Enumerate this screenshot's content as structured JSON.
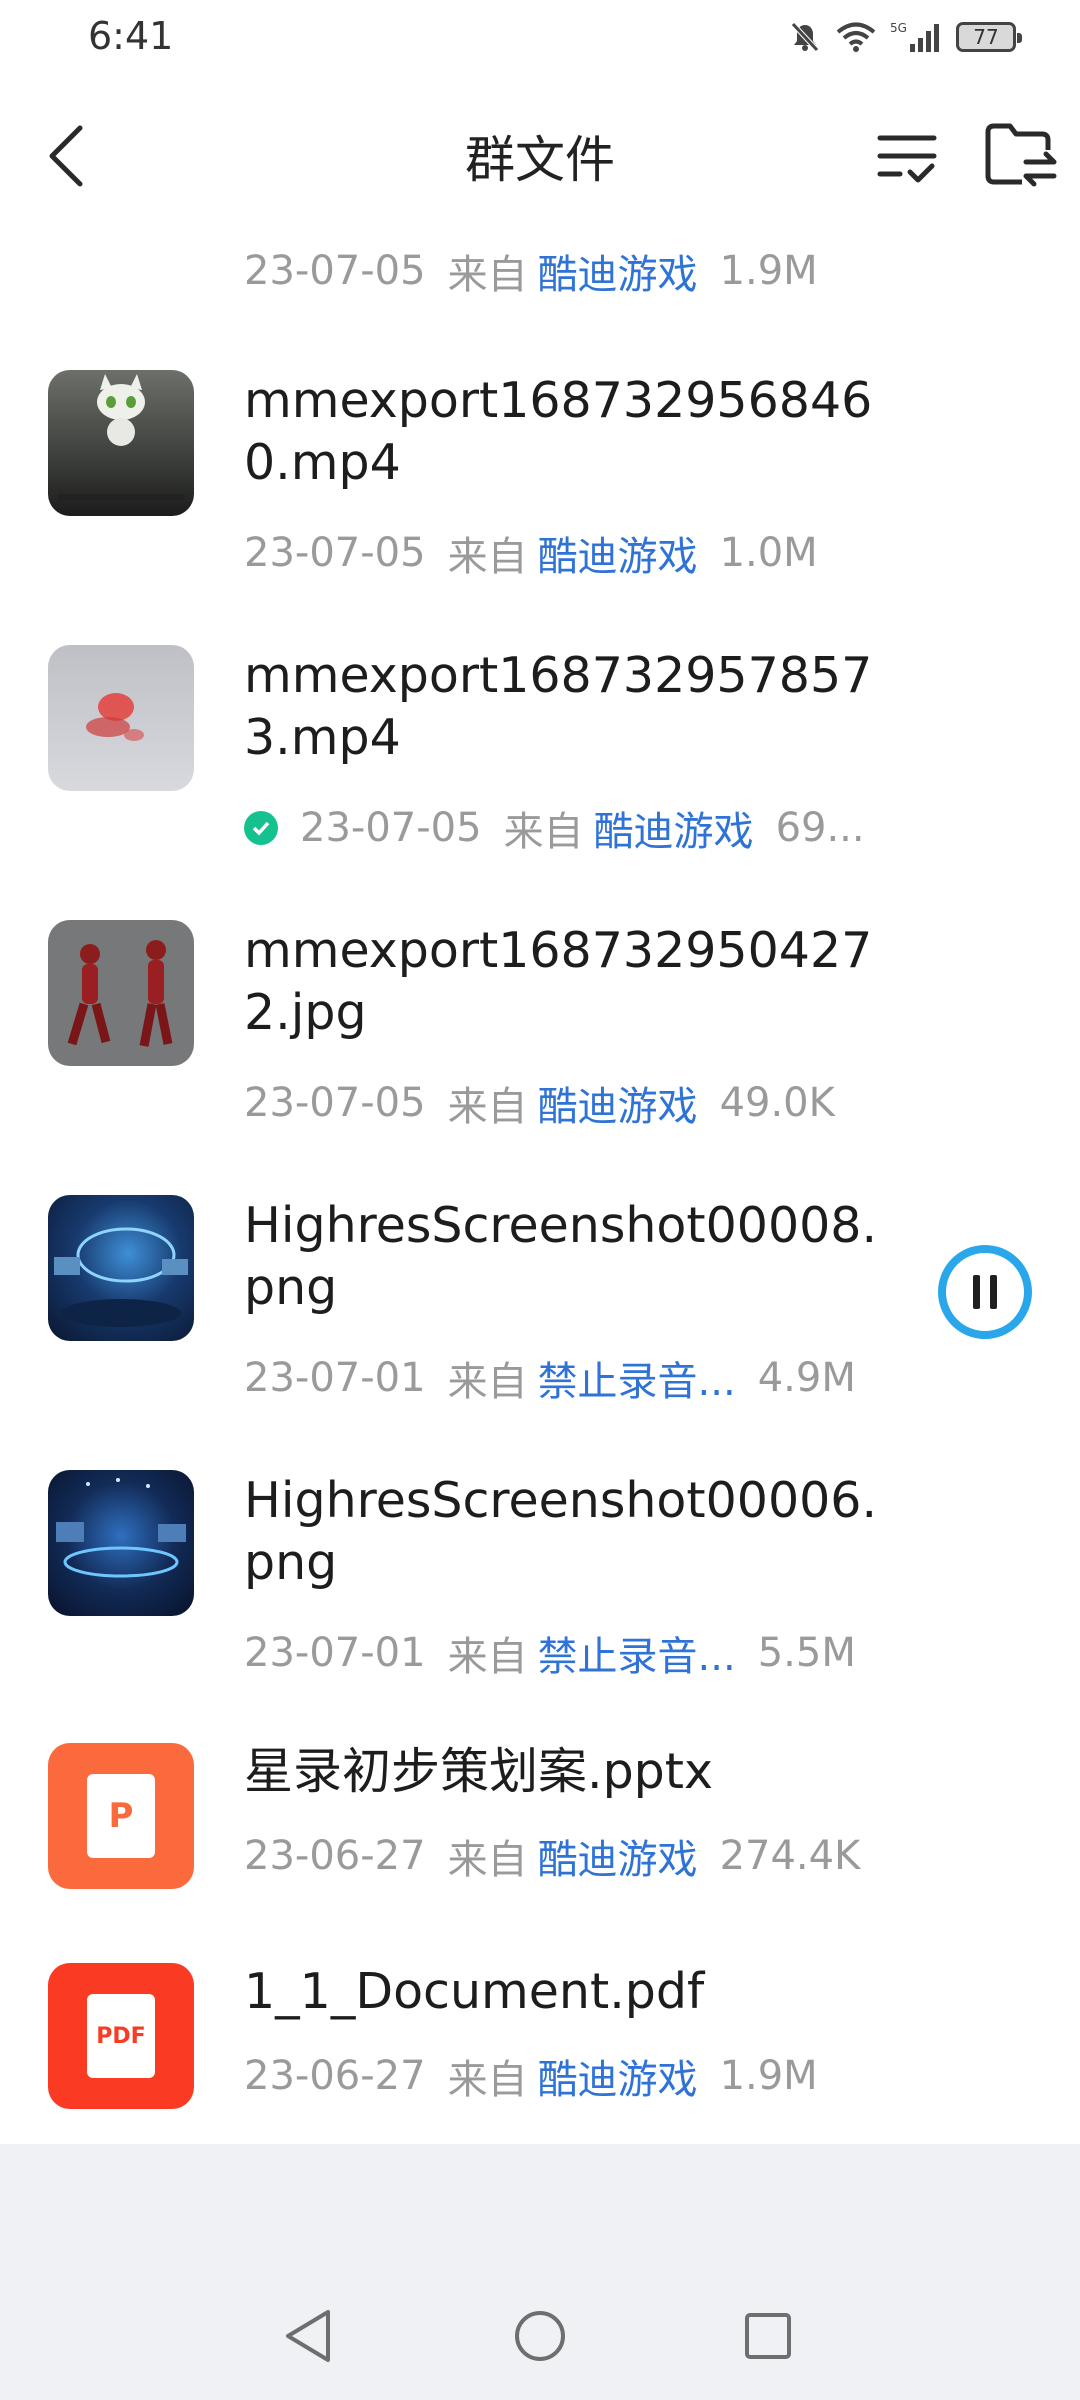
{
  "status_bar": {
    "time": "6:41",
    "battery": "77"
  },
  "header": {
    "title": "群文件"
  },
  "files": [
    {
      "name": "",
      "date": "23-07-05",
      "from_label": "来自",
      "sender": "酷迪游戏",
      "size": "1.9M"
    },
    {
      "name": "mmexport1687329568460.mp4",
      "date": "23-07-05",
      "from_label": "来自",
      "sender": "酷迪游戏",
      "size": "1.0M"
    },
    {
      "name": "mmexport1687329578573.mp4",
      "date": "23-07-05",
      "from_label": "来自",
      "sender": "酷迪游戏",
      "size": "69..."
    },
    {
      "name": "mmexport1687329504272.jpg",
      "date": "23-07-05",
      "from_label": "来自",
      "sender": "酷迪游戏",
      "size": "49.0K"
    },
    {
      "name": "HighresScreenshot00008.png",
      "date": "23-07-01",
      "from_label": "来自",
      "sender": "禁止录音...",
      "size": "4.9M"
    },
    {
      "name": "HighresScreenshot00006.png",
      "date": "23-07-01",
      "from_label": "来自",
      "sender": "禁止录音...",
      "size": "5.5M"
    },
    {
      "name": "星录初步策划案.pptx",
      "date": "23-06-27",
      "from_label": "来自",
      "sender": "酷迪游戏",
      "size": "274.4K"
    },
    {
      "name": "1_1_Document.pdf",
      "date": "23-06-27",
      "from_label": "来自",
      "sender": "酷迪游戏",
      "size": "1.9M"
    }
  ],
  "icons": {
    "pptx_letter": "P",
    "pdf_label": "PDF"
  },
  "colors": {
    "accent_blue": "#2f73d6",
    "download_ring": "#29a7ea",
    "success_green": "#15c28f",
    "pptx_orange": "#fa6a3c",
    "pdf_red": "#fa3a22"
  }
}
